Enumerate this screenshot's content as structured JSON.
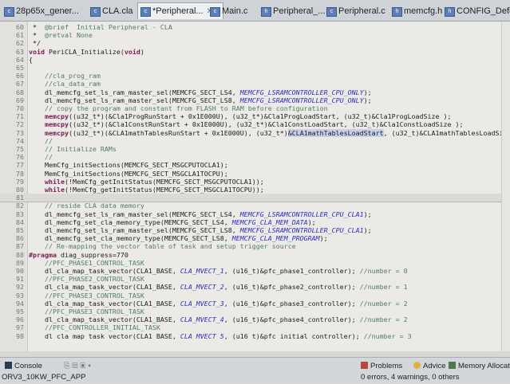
{
  "tabs": [
    {
      "label": "28p65x_gener..."
    },
    {
      "label": "CLA.cla"
    },
    {
      "label": "*Peripheral...",
      "close": "✕"
    },
    {
      "label": "Main.c"
    },
    {
      "label": "Peripheral_..."
    },
    {
      "label": "Peripheral.c"
    },
    {
      "label": "memcfg.h"
    },
    {
      "label": "CONFIG_Define.h"
    }
  ],
  "code_lines": [
    {
      "num": "60",
      "html": " *  <span class=\"cm\">@brief  Initial Peripheral - CLA</span>"
    },
    {
      "num": "61",
      "html": " *  <span class=\"cm\">@retval None</span>"
    },
    {
      "num": "62",
      "html": " */"
    },
    {
      "num": "63",
      "html": "<span class=\"kw\">void</span> PeriCLA_Initialize(<span class=\"kw\">void</span>)"
    },
    {
      "num": "64",
      "html": "{"
    },
    {
      "num": "65",
      "html": ""
    },
    {
      "num": "66",
      "html": "    <span class=\"cm\">//cla_prog_ram</span>"
    },
    {
      "num": "67",
      "html": "    <span class=\"cm\">//cla_data_ram</span>"
    },
    {
      "num": "68",
      "html": "    dl_memcfg_set_ls_ram_master_sel(MEMCFG_SECT_LS4, <span class=\"mac\">MEMCFG_LSRAMCONTROLLER_CPU_ONLY</span>);"
    },
    {
      "num": "69",
      "html": "    dl_memcfg_set_ls_ram_master_sel(MEMCFG_SECT_LS8, <span class=\"mac\">MEMCFG_LSRAMCONTROLLER_CPU_ONLY</span>);"
    },
    {
      "num": "70",
      "html": "    <span class=\"cm\">// copy the program and constant from FLASH to RAM before configuration</span>"
    },
    {
      "num": "71",
      "html": "    <span class=\"kw\">memcpy</span>((u32_t*)(&amp;Cla1ProgRunStart + 0x1E000U), (u32_t*)&amp;Cla1ProgLoadStart, (u32_t)&amp;Cla1ProgLoadSize );"
    },
    {
      "num": "72",
      "html": "    <span class=\"kw\">memcpy</span>((u32_t*)(&amp;Cla1ConstRunStart + 0x1E000U), (u32_t*)&amp;Cla1ConstLoadStart, (u32_t)&amp;Cla1ConstLoadSize );"
    },
    {
      "num": "73",
      "html": "    <span class=\"kw\">memcpy</span>((u32_t*)(&amp;CLA1mathTablesRunStart + 0x1E000U), (u32_t*)<span class=\"hl\">&amp;CLA1mathTablesLoadStart</span>, (u32_t)&amp;CLA1mathTablesLoadSize );"
    },
    {
      "num": "74",
      "html": "    <span class=\"cm\">//</span>"
    },
    {
      "num": "75",
      "html": "    <span class=\"cm\">// Initialize RAMs</span>"
    },
    {
      "num": "76",
      "html": "    <span class=\"cm\">//</span>"
    },
    {
      "num": "77",
      "html": "    MemCfg_initSections(MEMCFG_SECT_MSGCPUTOCLA1);"
    },
    {
      "num": "78",
      "html": "    MemCfg_initSections(MEMCFG_SECT_MSGCLA1TOCPU);"
    },
    {
      "num": "79",
      "html": "    <span class=\"kw\">while</span>(!MemCfg_getInitStatus(MEMCFG_SECT_MSGCPUTOCLA1));"
    },
    {
      "num": "80",
      "html": "    <span class=\"kw\">while</span>(!MemCfg_getInitStatus(MEMCFG_SECT_MSGCLA1TOCPU));"
    },
    {
      "num": "81",
      "html": ""
    },
    {
      "num": "82",
      "html": "    <span class=\"cm\">// reside CLA data memory</span>"
    },
    {
      "num": "83",
      "html": "    dl_memcfg_set_ls_ram_master_sel(MEMCFG_SECT_LS4, <span class=\"mac\">MEMCFG_LSRAMCONTROLLER_CPU_CLA1</span>);"
    },
    {
      "num": "84",
      "html": "    dl_memcfg_set_cla_memory_type(MEMCFG_SECT_LS4, <span class=\"mac\">MEMCFG_CLA_MEM_DATA</span>);"
    },
    {
      "num": "85",
      "html": "    dl_memcfg_set_ls_ram_master_sel(MEMCFG_SECT_LS8, <span class=\"mac\">MEMCFG_LSRAMCONTROLLER_CPU_CLA1</span>);"
    },
    {
      "num": "86",
      "html": "    dl_memcfg_set_cla_memory_type(MEMCFG_SECT_LS8, <span class=\"mac\">MEMCFG_CLA_MEM_PROGRAM</span>);"
    },
    {
      "num": "87",
      "html": "    <span class=\"cm\">// Re-mapping the vector table of task and setup trigger source</span>"
    },
    {
      "num": "88",
      "html": "<span class=\"kw\">#pragma</span> diag_suppress=770"
    },
    {
      "num": "89",
      "html": "    <span class=\"cm\">//PFC_PHASE1_CONTROL_TASK</span>"
    },
    {
      "num": "90",
      "html": "    dl_cla_map_task_vector(CLA1_BASE, <span class=\"mac\">CLA_MVECT_1</span>, (u16_t)&amp;pfc_phase1_controller); <span class=\"cm\">//number = 0</span>"
    },
    {
      "num": "91",
      "html": "    <span class=\"cm\">//PFC_PHASE2_CONTROL_TASK</span>"
    },
    {
      "num": "92",
      "html": "    dl_cla_map_task_vector(CLA1_BASE, <span class=\"mac\">CLA_MVECT_2</span>, (u16_t)&amp;pfc_phase2_controller); <span class=\"cm\">//number = 1</span>"
    },
    {
      "num": "93",
      "html": "    <span class=\"cm\">//PFC_PHASE3_CONTROL_TASK</span>"
    },
    {
      "num": "94",
      "html": "    dl_cla_map_task_vector(CLA1_BASE, <span class=\"mac\">CLA_MVECT_3</span>, (u16_t)&amp;pfc_phase3_controller); <span class=\"cm\">//number = 2</span>"
    },
    {
      "num": "95",
      "html": "    <span class=\"cm\">//PFC_PHASE3_CONTROL_TASK</span>"
    },
    {
      "num": "96",
      "html": "    dl_cla_map_task_vector(CLA1_BASE, <span class=\"mac\">CLA_MVECT_4</span>, (u16_t)&amp;pfc_phase4_controller); <span class=\"cm\">//number = 2</span>"
    },
    {
      "num": "97",
      "html": "    <span class=\"cm\">//PFC_CONTROLLER_INITIAL_TASK</span>"
    },
    {
      "num": "98",
      "html": "    dl cla map task vector(CLA1 BASE, <span class=\"mac\">CLA MVECT 5</span>, (u16 t)&amp;pfc initial controller); <span class=\"cm\">//number = 3</span>"
    }
  ],
  "bottom": {
    "console_label": "Console",
    "problems_label": "Problems",
    "advice_label": "Advice",
    "memory_label": "Memory Allocation",
    "project_label": "ORV3_10KW_PFC_APP",
    "status_text": "0 errors, 4 warnings, 0 others"
  },
  "colors": {
    "keyword": "#7a1a52",
    "comment": "#4f7f5f",
    "macro": "#2b2bbf",
    "highlight": "#c6d0e8"
  }
}
